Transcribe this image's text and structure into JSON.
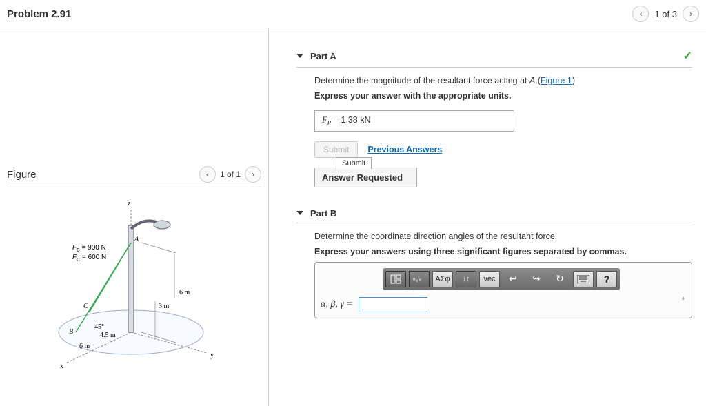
{
  "header": {
    "title": "Problem 2.91",
    "page_of": "1 of 3"
  },
  "figure": {
    "title": "Figure",
    "page_of": "1 of 1",
    "labels": {
      "FB": "F_B = 900 N",
      "FC": "F_C = 600 N",
      "A": "A",
      "B": "B",
      "C": "C",
      "ang": "45°",
      "d45": "4.5 m",
      "d6a": "6 m",
      "d6b": "6 m",
      "d3": "3 m",
      "ax_x": "x",
      "ax_y": "y",
      "ax_z": "z"
    }
  },
  "partA": {
    "title": "Part A",
    "prompt_pre": "Determine the magnitude of the resultant force acting at ",
    "prompt_var": "A",
    "prompt_post": ".(",
    "fig_link": "Figure 1",
    "prompt_close": ")",
    "instruction": "Express your answer with the appropriate units.",
    "var_label": "F",
    "var_sub": "R",
    "eq": " =  ",
    "value": "1.38 kN",
    "submit": "Submit",
    "prev": "Previous Answers",
    "tab": "Submit",
    "answer_req": "Answer Requested"
  },
  "partB": {
    "title": "Part B",
    "prompt": "Determine the coordinate direction angles of the resultant force.",
    "instruction": "Express your answers using three significant figures separated by commas.",
    "toolbar": {
      "templates_icon": "templates-icon",
      "root_icon": "root-icon",
      "greek": "ΑΣφ",
      "subscript_icon": "subscript-icon",
      "vec": "vec",
      "undo_icon": "undo-icon",
      "redo_icon": "redo-icon",
      "reset_icon": "reset-icon",
      "keyboard_icon": "keyboard-icon",
      "help": "?"
    },
    "vars": "α, β, γ =",
    "unit_hint": "°"
  }
}
